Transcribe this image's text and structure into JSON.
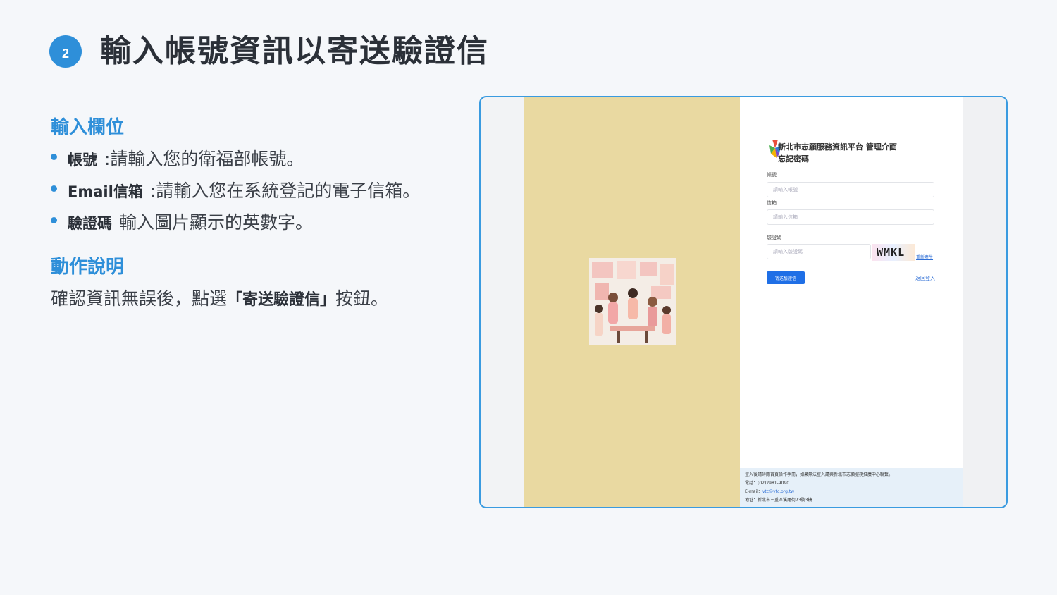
{
  "slide": {
    "step_number": "2",
    "title": "輸入帳號資訊以寄送驗證信",
    "section_input_heading": "輸入欄位",
    "bullets": [
      {
        "term": "帳號",
        "desc": ":請輸入您的衛福部帳號。"
      },
      {
        "term": "Email信箱",
        "desc": ":請輸入您在系統登記的電子信箱。"
      },
      {
        "term": "驗證碼",
        "desc": "輸入圖片顯示的英數字。"
      }
    ],
    "section_action_heading": "動作說明",
    "action_prefix": "確認資訊無誤後，點選",
    "action_button_name": "「寄送驗證信」",
    "action_suffix": "按鈕。"
  },
  "screenshot": {
    "platform_title": "新北市志願服務資訊平台 管理介面",
    "page_title": "忘記密碼",
    "account_label": "帳號",
    "account_placeholder": "請輸入帳號",
    "email_label": "信箱",
    "email_placeholder": "請輸入信箱",
    "captcha_label": "驗證碼",
    "captcha_placeholder": "請輸入驗證碼",
    "captcha_text": "WMKL",
    "refresh_label": "重新產生",
    "send_button_label": "寄送驗證信",
    "back_link_label": "返回登入",
    "footer_note": "登入後請詳閱首頁操作手冊，如果無法登入請與新北市志願服務推廣中心聯繫。",
    "footer_phone": "電話：(02)2981-9090",
    "footer_email_prefix": "E-mail：",
    "footer_email": "vtc@vtc.org.tw",
    "footer_address": "地址：新北市三重區溪尾街73號3樓"
  },
  "colors": {
    "accent": "#2e8fd9",
    "panel_yellow": "#e9d9a1",
    "button_blue": "#1f6fe6"
  }
}
